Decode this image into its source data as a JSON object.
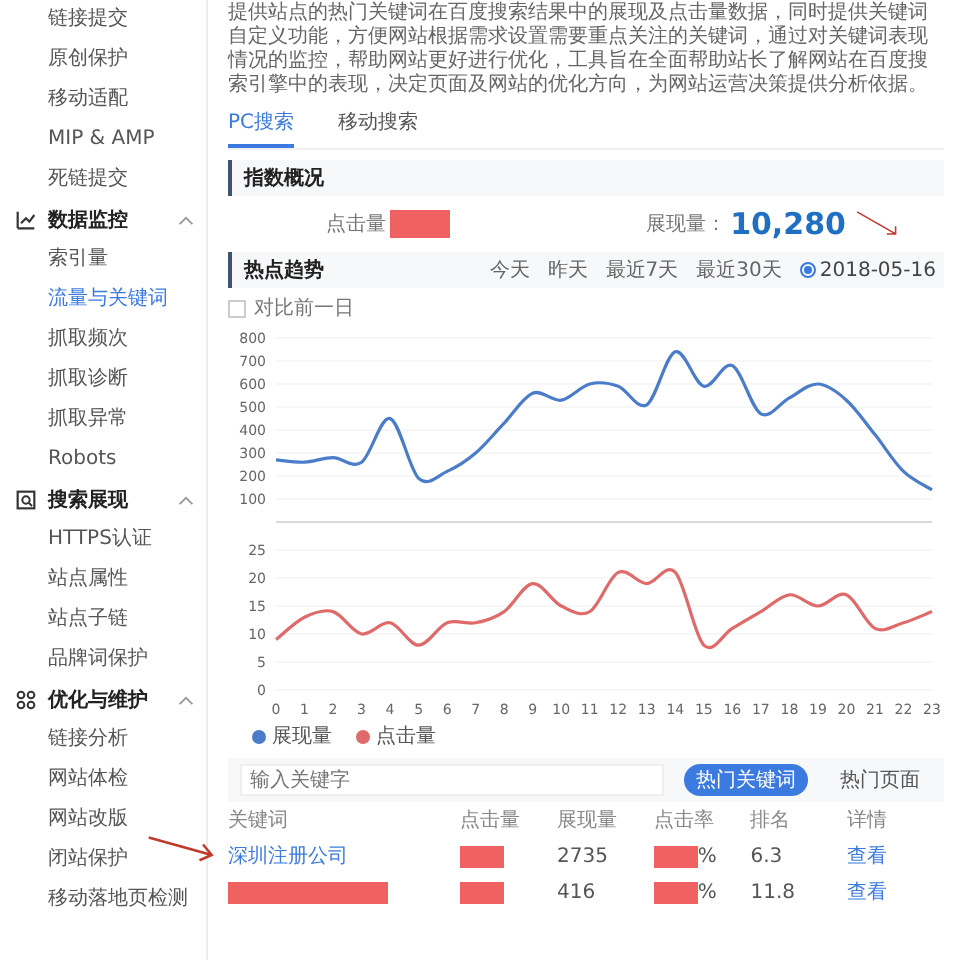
{
  "sidebar": {
    "groups": [
      {
        "items": [
          {
            "label": "链接提交",
            "selected": false
          },
          {
            "label": "原创保护",
            "selected": false
          },
          {
            "label": "移动适配",
            "selected": false
          },
          {
            "label": "MIP & AMP",
            "selected": false
          },
          {
            "label": "死链提交",
            "selected": false
          }
        ]
      },
      {
        "title": "数据监控",
        "expanded": true,
        "items": [
          {
            "label": "索引量",
            "selected": false
          },
          {
            "label": "流量与关键词",
            "selected": true
          },
          {
            "label": "抓取频次",
            "selected": false
          },
          {
            "label": "抓取诊断",
            "selected": false
          },
          {
            "label": "抓取异常",
            "selected": false
          },
          {
            "label": "Robots",
            "selected": false
          }
        ]
      },
      {
        "title": "搜索展现",
        "expanded": true,
        "items": [
          {
            "label": "HTTPS认证",
            "selected": false
          },
          {
            "label": "站点属性",
            "selected": false
          },
          {
            "label": "站点子链",
            "selected": false
          },
          {
            "label": "品牌词保护",
            "selected": false
          }
        ]
      },
      {
        "title": "优化与维护",
        "expanded": true,
        "items": [
          {
            "label": "链接分析",
            "selected": false
          },
          {
            "label": "网站体检",
            "selected": false
          },
          {
            "label": "网站改版",
            "selected": false
          },
          {
            "label": "闭站保护",
            "selected": false
          },
          {
            "label": "移动落地页检测",
            "selected": false
          }
        ]
      }
    ]
  },
  "intro": "提供站点的热门关键词在百度搜索结果中的展现及点击量数据，同时提供关键词自定义功能，方便网站根据需求设置需要重点关注的关键词，通过对关键词表现情况的监控，帮助网站更好进行优化，工具旨在全面帮助站长了解网站在百度搜索引擎中的表现，决定页面及网站的优化方向，为网站运营决策提供分析依据。",
  "tabs": [
    {
      "label": "PC搜索",
      "selected": true
    },
    {
      "label": "移动搜索",
      "selected": false
    }
  ],
  "overview": {
    "title": "指数概况",
    "stats": [
      {
        "label": "点击量",
        "redacted": true
      },
      {
        "label": "展现量：",
        "value": "10,280"
      }
    ]
  },
  "trend": {
    "title": "热点趋势",
    "ranges": [
      {
        "label": "今天",
        "selected": false
      },
      {
        "label": "昨天",
        "selected": false
      },
      {
        "label": "最近7天",
        "selected": false
      },
      {
        "label": "最近30天",
        "selected": false
      },
      {
        "label": "2018-05-16",
        "selected": true
      }
    ],
    "compare": {
      "label": "对比前一日",
      "checked": false
    },
    "charts": [
      {
        "chart_data": {
          "type": "line",
          "grid": true,
          "ylim": [
            0,
            800
          ],
          "yticks": [
            100,
            200,
            300,
            400,
            500,
            600,
            700,
            800
          ],
          "series": [
            {
              "name": "展现量",
              "color": "#4a7cc9",
              "values": [
                270,
                260,
                280,
                260,
                450,
                190,
                220,
                300,
                430,
                560,
                530,
                600,
                590,
                510,
                740,
                590,
                680,
                470,
                540,
                600,
                530,
                380,
                220,
                140
              ]
            }
          ]
        }
      },
      {
        "chart_data": {
          "type": "line",
          "grid": true,
          "xlim": [
            0,
            23
          ],
          "x": [
            0,
            1,
            2,
            3,
            4,
            5,
            6,
            7,
            8,
            9,
            10,
            11,
            12,
            13,
            14,
            15,
            16,
            17,
            18,
            19,
            20,
            21,
            22,
            23
          ],
          "xticks": [
            0,
            1,
            2,
            3,
            4,
            5,
            6,
            7,
            8,
            9,
            10,
            11,
            12,
            13,
            14,
            15,
            16,
            17,
            18,
            19,
            20,
            21,
            22,
            23
          ],
          "ylim": [
            0,
            25
          ],
          "yticks": [
            0,
            5,
            10,
            15,
            20,
            25
          ],
          "series": [
            {
              "name": "点击量",
              "color": "#e06a6a",
              "values": [
                9,
                13,
                14,
                10,
                12,
                8,
                12,
                12,
                14,
                19,
                15,
                14,
                21,
                19,
                21,
                8,
                11,
                14,
                17,
                15,
                17,
                11,
                12,
                14
              ]
            }
          ]
        }
      }
    ]
  },
  "keywords": {
    "placeholder": "输入关键字",
    "views": [
      {
        "label": "热门关键词",
        "selected": true
      },
      {
        "label": "热门页面",
        "selected": false
      }
    ],
    "columns": [
      "关键词",
      "点击量",
      "展现量",
      "点击率",
      "排名",
      "详情"
    ],
    "rows": [
      [
        {
          "text": "深圳注册公司",
          "link": true
        },
        {
          "redacted": true
        },
        {
          "text": "2735"
        },
        {
          "redacted": true,
          "suffix": "%"
        },
        {
          "text": "6.3"
        },
        {
          "text": "查看",
          "link": true
        }
      ],
      [
        {
          "redacted": true
        },
        {
          "redacted": true
        },
        {
          "text": "416"
        },
        {
          "redacted": true,
          "suffix": "%"
        },
        {
          "text": "11.8"
        },
        {
          "text": "查看",
          "link": true
        }
      ]
    ]
  }
}
